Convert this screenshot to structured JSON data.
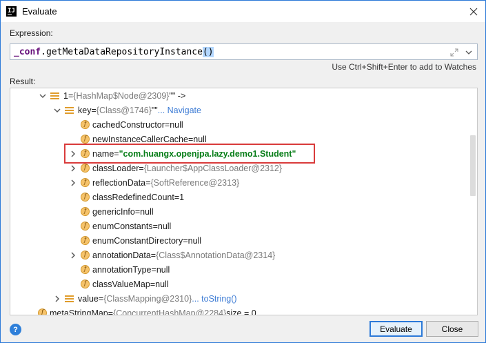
{
  "window": {
    "title": "Evaluate",
    "app_icon": "intellij-icon"
  },
  "expression": {
    "label": "Expression:",
    "var_part": "_conf",
    "method_part": ".getMetaDataRepositoryInstance",
    "paren_part": "()"
  },
  "hint": "Use Ctrl+Shift+Enter to add to Watches",
  "result_label": "Result:",
  "tree": [
    {
      "name": "1",
      "eq": " = ",
      "type": "{HashMap$Node@2309}",
      "suffix": " \"\" ->",
      "link": ""
    },
    {
      "name": "key",
      "eq": " = ",
      "type": "{Class@1746}",
      "suffix": " \"\"",
      "link": "... Navigate"
    },
    {
      "name": "cachedConstructor",
      "eq": " = ",
      "value": "null"
    },
    {
      "name": "newInstanceCallerCache",
      "eq": " = ",
      "value": "null"
    },
    {
      "name": "name",
      "eq": " = ",
      "strval": "\"com.huangx.openjpa.lazy.demo1.Student\""
    },
    {
      "name": "classLoader",
      "eq": " = ",
      "type": "{Launcher$AppClassLoader@2312}"
    },
    {
      "name": "reflectionData",
      "eq": " = ",
      "type": "{SoftReference@2313}"
    },
    {
      "name": "classRedefinedCount",
      "eq": " = ",
      "value": "1"
    },
    {
      "name": "genericInfo",
      "eq": " = ",
      "value": "null"
    },
    {
      "name": "enumConstants",
      "eq": " = ",
      "value": "null"
    },
    {
      "name": "enumConstantDirectory",
      "eq": " = ",
      "value": "null"
    },
    {
      "name": "annotationData",
      "eq": " = ",
      "type": "{Class$AnnotationData@2314}"
    },
    {
      "name": "annotationType",
      "eq": " = ",
      "value": "null"
    },
    {
      "name": "classValueMap",
      "eq": " = ",
      "value": "null"
    },
    {
      "name": "value",
      "eq": " = ",
      "type": "{ClassMapping@2310}",
      "link": " ... toString()"
    },
    {
      "name": "metaStringMap",
      "eq": " = ",
      "type": "{ConcurrentHashMap@2284}",
      "suffix": "  size = 0"
    }
  ],
  "buttons": {
    "evaluate": "Evaluate",
    "close": "Close"
  },
  "colors": {
    "accent": "#2b79d8",
    "highlight": "#d93b3b",
    "string_value": "#067d17"
  }
}
